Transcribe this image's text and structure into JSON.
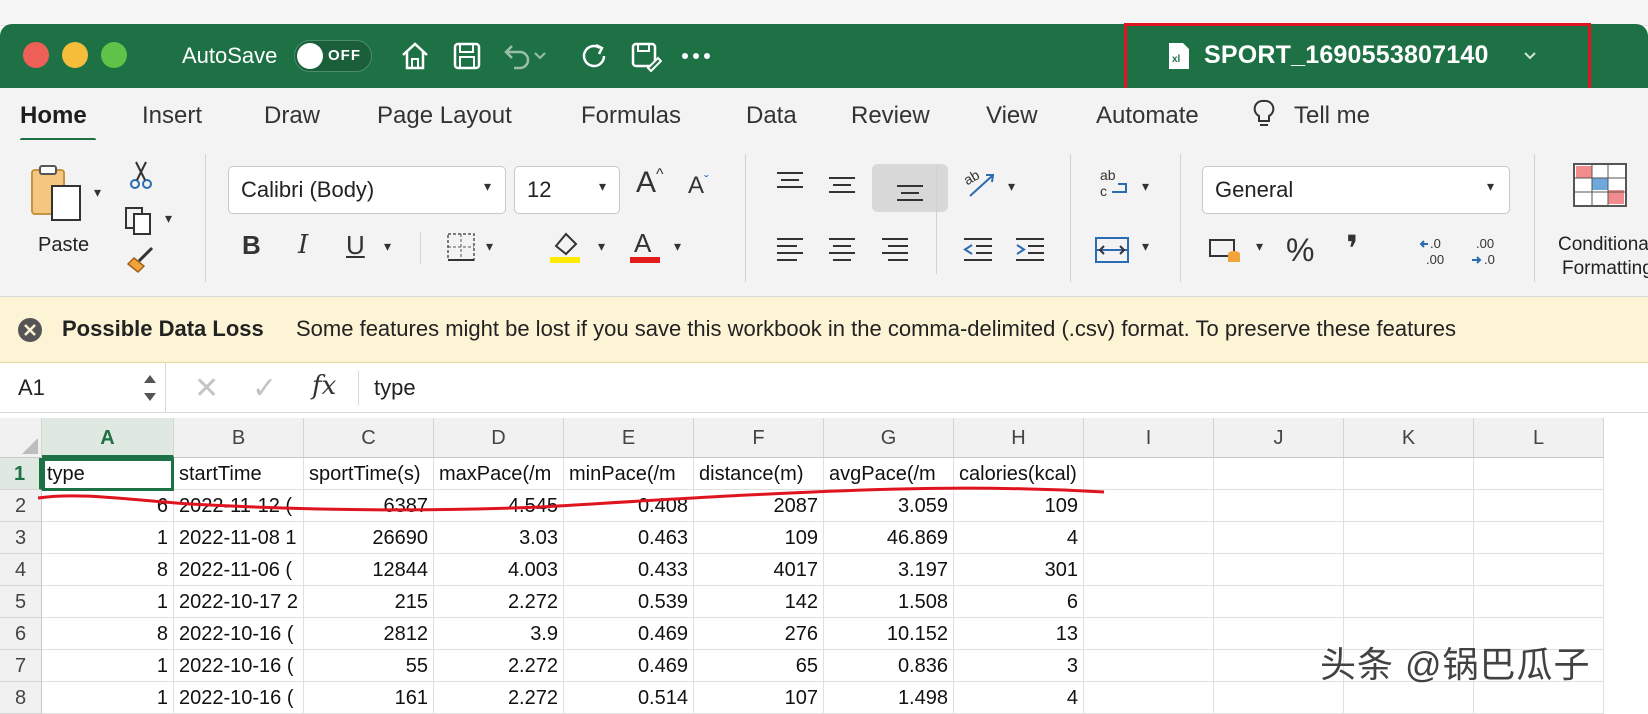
{
  "titlebar": {
    "autosave_label": "AutoSave",
    "autosave_state": "OFF",
    "filename": "SPORT_1690553807140",
    "colors": {
      "bar": "#1e7145",
      "close": "#ee5f57",
      "minimize": "#f6bd3a",
      "zoom": "#5fc347",
      "annotation": "#e0141e"
    }
  },
  "tabs": [
    "Home",
    "Insert",
    "Draw",
    "Page Layout",
    "Formulas",
    "Data",
    "Review",
    "View",
    "Automate"
  ],
  "tell_me": "Tell me",
  "ribbon": {
    "paste_label": "Paste",
    "font_name": "Calibri (Body)",
    "font_size": "12",
    "number_format": "General",
    "cond_format_line1": "Conditional",
    "cond_format_line2": "Formatting",
    "bold": "B",
    "italic": "I",
    "underline": "U",
    "percent": "%"
  },
  "message_bar": {
    "title": "Possible Data Loss",
    "text": "Some features might be lost if you save this workbook in the comma-delimited (.csv) format. To preserve these features"
  },
  "formula_bar": {
    "name_box": "A1",
    "fx": "fx",
    "value": "type"
  },
  "sheet": {
    "columns": [
      "A",
      "B",
      "C",
      "D",
      "E",
      "F",
      "G",
      "H",
      "I",
      "J",
      "K",
      "L"
    ],
    "row_numbers": [
      "1",
      "2",
      "3",
      "4",
      "5",
      "6",
      "7",
      "8"
    ],
    "headers": [
      "type",
      "startTime",
      "sportTime(s)",
      "maxPace(/m",
      "minPace(/m",
      "distance(m)",
      "avgPace(/m",
      "calories(kcal)"
    ],
    "rows": [
      [
        "6",
        "2022-11-12 (",
        "6387",
        "4.545",
        "0.408",
        "2087",
        "3.059",
        "109"
      ],
      [
        "1",
        "2022-11-08 1",
        "26690",
        "3.03",
        "0.463",
        "109",
        "46.869",
        "4"
      ],
      [
        "8",
        "2022-11-06 (",
        "12844",
        "4.003",
        "0.433",
        "4017",
        "3.197",
        "301"
      ],
      [
        "1",
        "2022-10-17 2",
        "215",
        "2.272",
        "0.539",
        "142",
        "1.508",
        "6"
      ],
      [
        "8",
        "2022-10-16 (",
        "2812",
        "3.9",
        "0.469",
        "276",
        "10.152",
        "13"
      ],
      [
        "1",
        "2022-10-16 (",
        "55",
        "2.272",
        "0.469",
        "65",
        "0.836",
        "3"
      ],
      [
        "1",
        "2022-10-16 (",
        "161",
        "2.272",
        "0.514",
        "107",
        "1.498",
        "4"
      ]
    ]
  },
  "watermark": "头条 @锅巴瓜子"
}
